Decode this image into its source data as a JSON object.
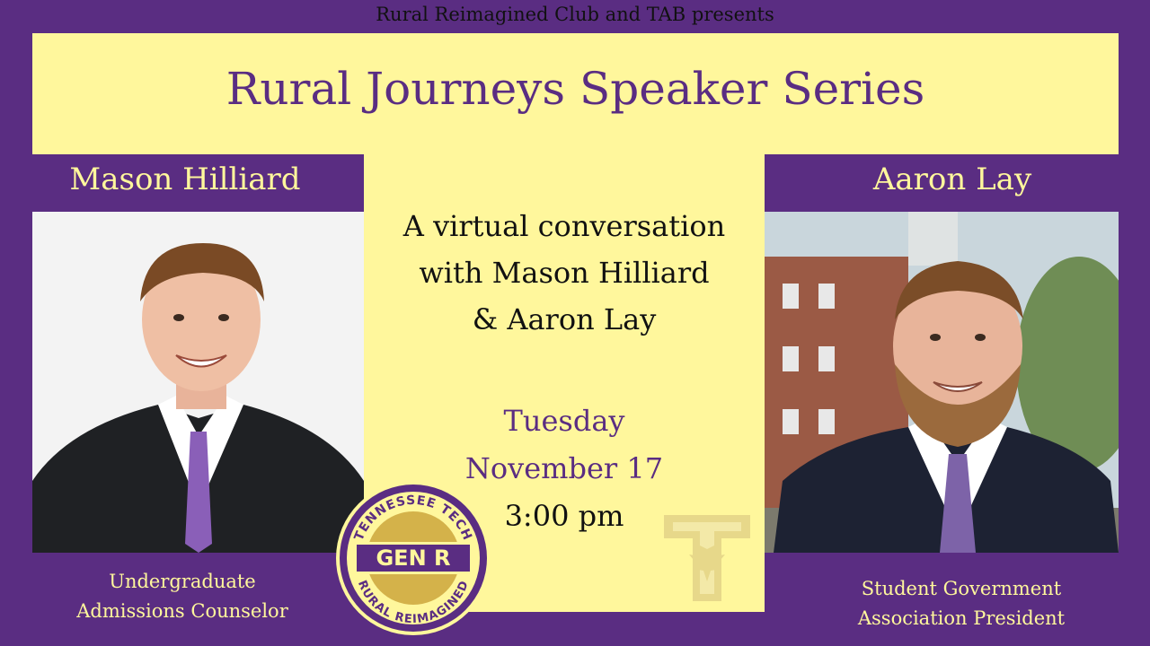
{
  "presenter_line": "Rural Reimagined Club and TAB presents",
  "title": "Rural Journeys Speaker Series",
  "speakers": [
    {
      "name": "Mason Hilliard",
      "caption_line1": "Undergraduate",
      "caption_line2": "Admissions Counselor"
    },
    {
      "name": "Aaron Lay",
      "caption_line1": "Student Government",
      "caption_line2": "Association President"
    }
  ],
  "description": {
    "line1": "A virtual conversation",
    "line2": "with Mason Hilliard",
    "line3": "& Aaron Lay"
  },
  "event": {
    "day": "Tuesday",
    "date": "November 17",
    "time": "3:00 pm"
  },
  "badge": {
    "top_text": "TENNESSEE TECH",
    "center_text": "GEN R",
    "bottom_text": "RURAL REIMAGINED"
  },
  "colors": {
    "purple": "#5a2d82",
    "yellow": "#fff79c",
    "gold": "#d4b24a"
  }
}
